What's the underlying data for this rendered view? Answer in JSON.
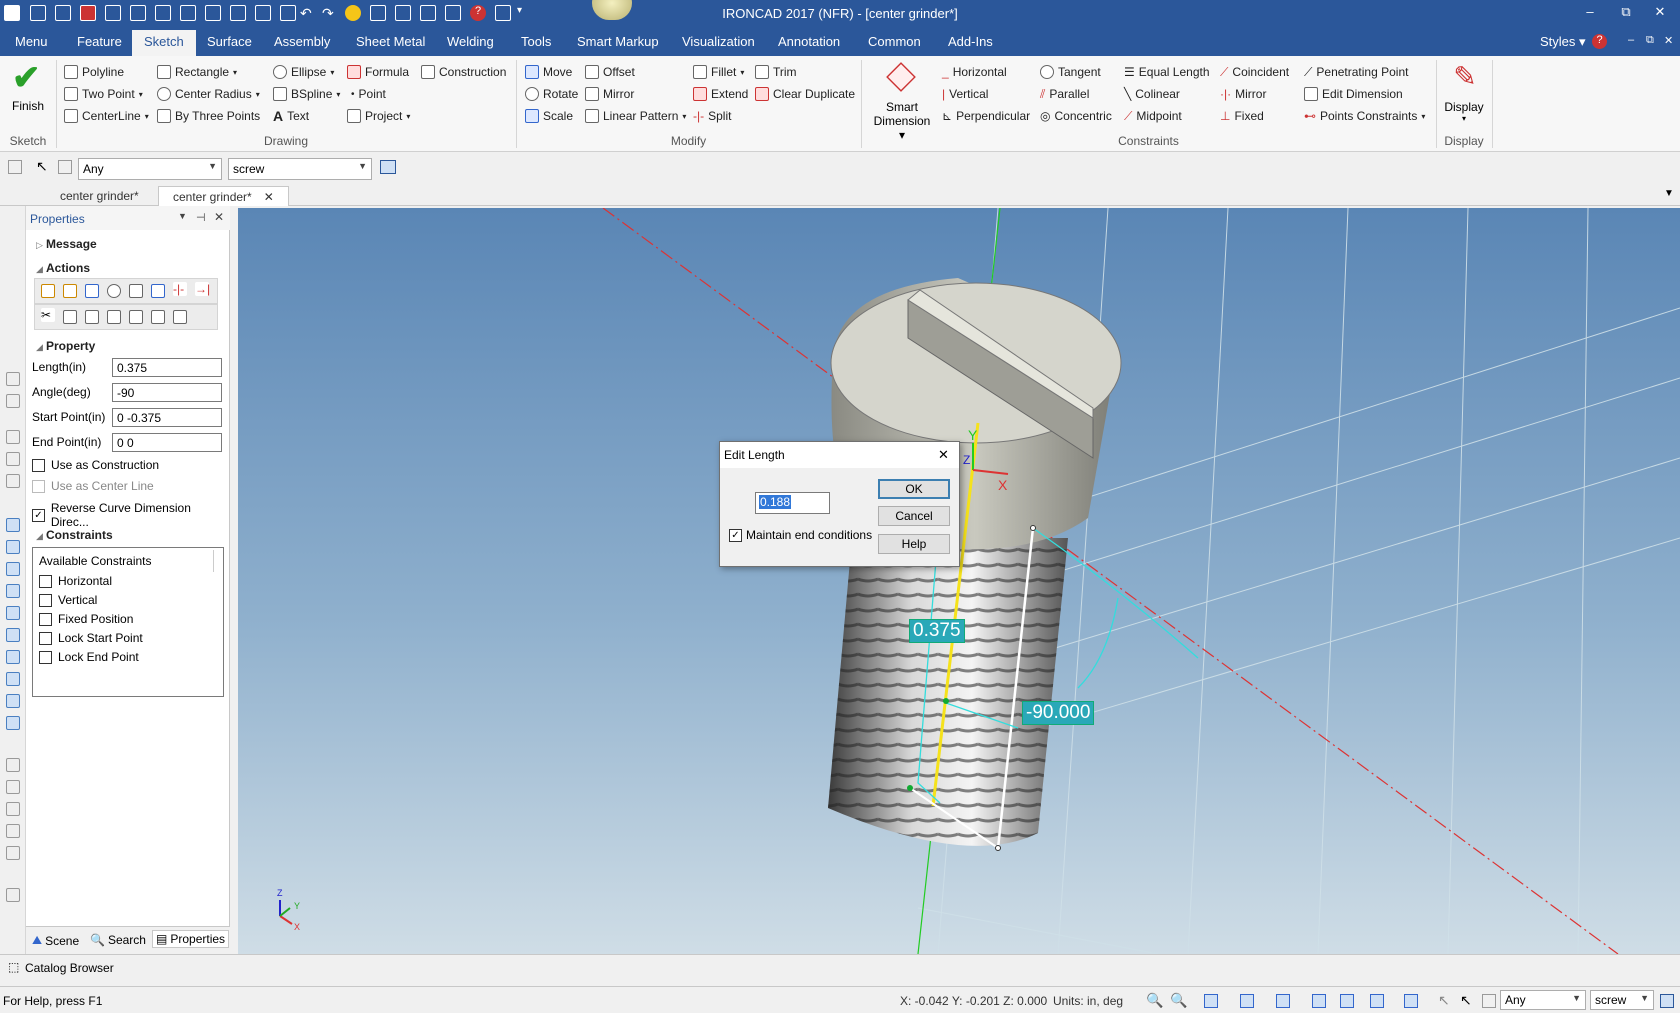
{
  "window": {
    "title": "IRONCAD 2017 (NFR) - [center grinder*]",
    "minimize": "–",
    "restore": "⧉",
    "close": "✕"
  },
  "menu": {
    "tabs": [
      "Menu",
      "Feature",
      "Sketch",
      "Surface",
      "Assembly",
      "Sheet Metal",
      "Welding",
      "Tools",
      "Smart Markup",
      "Visualization",
      "Annotation",
      "Common",
      "Add-Ins"
    ],
    "active": "Sketch",
    "styles": "Styles"
  },
  "ribbon": {
    "sketch": {
      "finish": "Finish",
      "group": "Sketch"
    },
    "drawing": {
      "group": "Drawing",
      "items": [
        "Polyline",
        "Rectangle",
        "Ellipse",
        "Formula",
        "Construction",
        "Two Point",
        "Center Radius",
        "BSpline",
        "Point",
        "CenterLine",
        "By Three Points",
        "Text",
        "Project"
      ]
    },
    "modify": {
      "group": "Modify",
      "items": [
        "Move",
        "Offset",
        "Fillet",
        "Trim",
        "Rotate",
        "Mirror",
        "Extend",
        "Clear Duplicate",
        "Scale",
        "Linear Pattern",
        "Split"
      ]
    },
    "constraints": {
      "group": "Constraints",
      "smart1": "Smart",
      "smart2": "Dimension",
      "items": [
        "Horizontal",
        "Tangent",
        "Equal Length",
        "Coincident",
        "Penetrating Point",
        "Vertical",
        "Parallel",
        "Colinear",
        "Mirror",
        "Edit Dimension",
        "Perpendicular",
        "Concentric",
        "Midpoint",
        "Fixed",
        "Points Constraints"
      ]
    },
    "display": {
      "label": "Display",
      "group": "Display"
    }
  },
  "toolbar": {
    "filter": "Any",
    "scope": "screw"
  },
  "doc_tabs": [
    "center grinder*",
    "center grinder*"
  ],
  "properties": {
    "title": "Properties",
    "message": "Message",
    "actions": "Actions",
    "property": "Property",
    "fields": [
      {
        "label": "Length(in)",
        "value": "0.375"
      },
      {
        "label": "Angle(deg)",
        "value": "-90"
      },
      {
        "label": "Start Point(in)",
        "value": "0 -0.375"
      },
      {
        "label": "End Point(in)",
        "value": "0 0"
      }
    ],
    "use_construction": "Use as Construction",
    "use_center": "Use as Center Line",
    "reverse": "Reverse Curve Dimension Direc...",
    "constraints": "Constraints",
    "available": "Available Constraints",
    "constraint_items": [
      "Horizontal",
      "Vertical",
      "Fixed Position",
      "Lock Start Point",
      "Lock End Point"
    ],
    "bottom_tabs": [
      "Scene",
      "Search",
      "Properties"
    ]
  },
  "viewport": {
    "dim_length": "0.375",
    "dim_angle": "-90.000",
    "axis_z": "Z",
    "axis_x": "X",
    "axis_y": "Y",
    "gizmo_z": "Z",
    "gizmo_y": "Y",
    "gizmo_x": "X"
  },
  "dialog": {
    "title": "Edit Length",
    "value": "0.188",
    "maintain": "Maintain end conditions",
    "ok": "OK",
    "cancel": "Cancel",
    "help": "Help",
    "close": "✕"
  },
  "catalog": "Catalog Browser",
  "status": {
    "help": "For Help, press F1",
    "coords": "X: -0.042 Y: -0.201 Z: 0.000",
    "units": "Units: in, deg",
    "filter": "Any",
    "scope": "screw"
  }
}
